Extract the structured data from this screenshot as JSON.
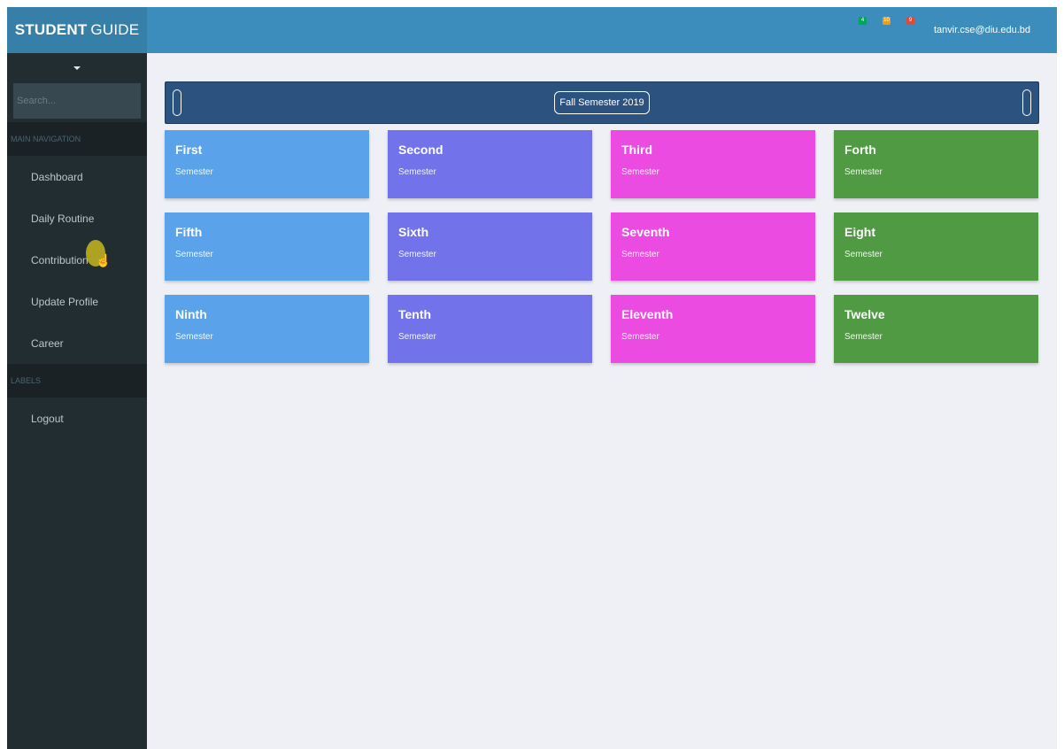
{
  "brand": {
    "bold": "STUDENT",
    "light": "GUIDE"
  },
  "search": {
    "placeholder": "Search..."
  },
  "sidebar": {
    "main_header": "MAIN NAVIGATION",
    "items": [
      {
        "label": "Dashboard"
      },
      {
        "label": "Daily Routine"
      },
      {
        "label": "Contribution"
      },
      {
        "label": "Update Profile"
      },
      {
        "label": "Career"
      }
    ],
    "labels_header": "LABELS",
    "logout": "Logout"
  },
  "topbar": {
    "notifications": [
      {
        "count": "4",
        "color": "#00a65a"
      },
      {
        "count": "10",
        "color": "#f39c12"
      },
      {
        "count": "9",
        "color": "#dd4b39"
      }
    ],
    "user_email": "tanvir.cse@diu.edu.bd"
  },
  "semester_selector": {
    "label": "Fall Semester 2019"
  },
  "cards": [
    {
      "title": "First",
      "subtitle": "Semester",
      "color": "#5aa2e9"
    },
    {
      "title": "Second",
      "subtitle": "Semester",
      "color": "#7273ea"
    },
    {
      "title": "Third",
      "subtitle": "Semester",
      "color": "#eb4be0"
    },
    {
      "title": "Forth",
      "subtitle": "Semester",
      "color": "#4f9a42"
    },
    {
      "title": "Fifth",
      "subtitle": "Semester",
      "color": "#5aa2e9"
    },
    {
      "title": "Sixth",
      "subtitle": "Semester",
      "color": "#7273ea"
    },
    {
      "title": "Seventh",
      "subtitle": "Semester",
      "color": "#eb4be0"
    },
    {
      "title": "Eight",
      "subtitle": "Semester",
      "color": "#4f9a42"
    },
    {
      "title": "Ninth",
      "subtitle": "Semester",
      "color": "#5aa2e9"
    },
    {
      "title": "Tenth",
      "subtitle": "Semester",
      "color": "#7273ea"
    },
    {
      "title": "Eleventh",
      "subtitle": "Semester",
      "color": "#eb4be0"
    },
    {
      "title": "Twelve",
      "subtitle": "Semester",
      "color": "#4f9a42"
    }
  ]
}
